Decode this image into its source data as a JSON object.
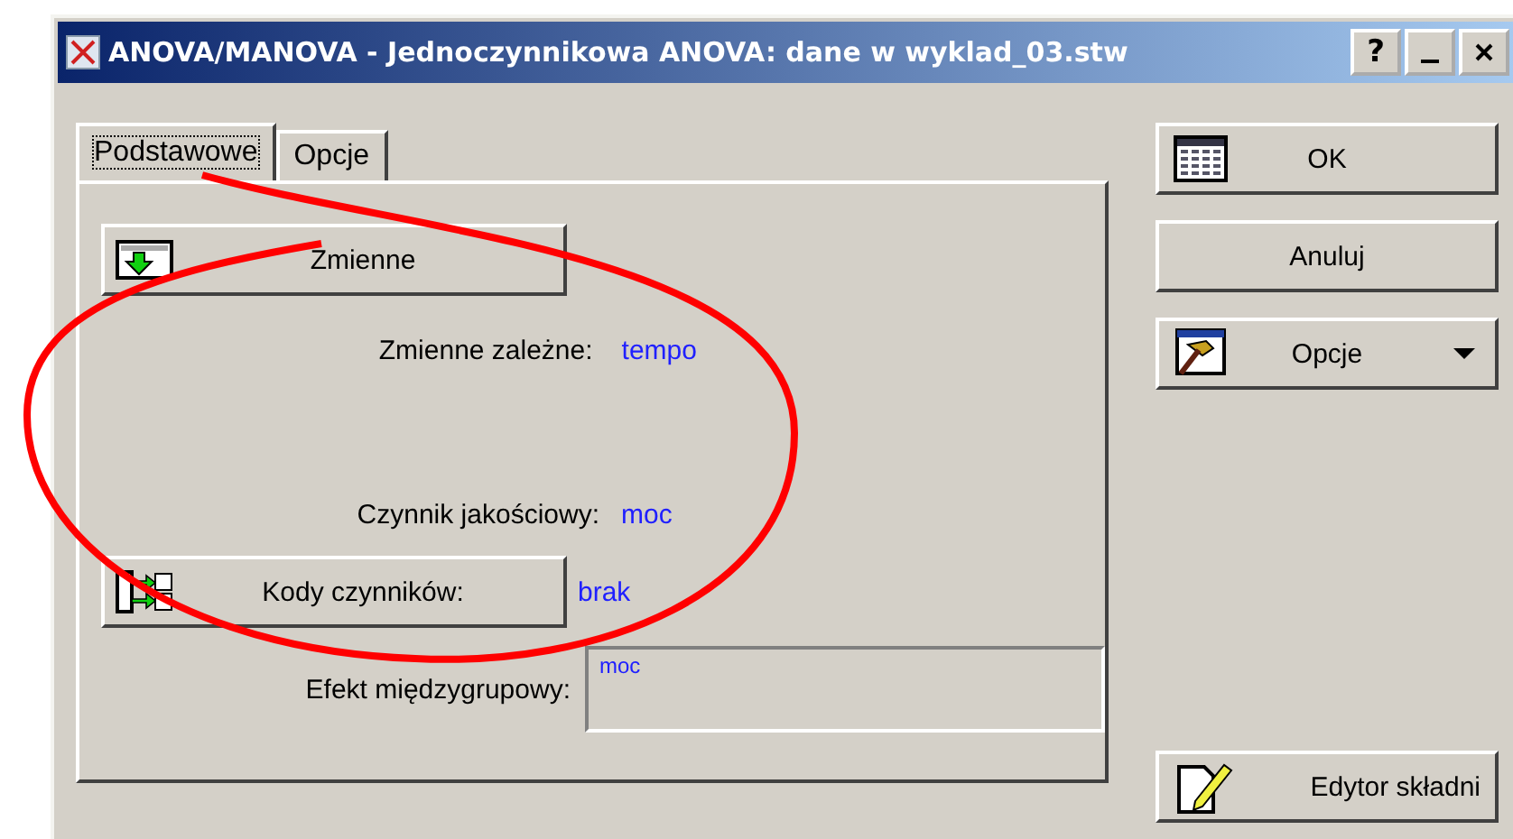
{
  "window": {
    "title": "ANOVA/MANOVA - Jednoczynnikowa ANOVA: dane w wyklad_03.stw",
    "help_button": "?"
  },
  "tabs": [
    {
      "label": "Podstawowe",
      "selected": true
    },
    {
      "label": "Opcje",
      "selected": false
    }
  ],
  "variables_button": "Zmienne",
  "fields": [
    {
      "label": "Zmienne zależne:",
      "value": "tempo"
    },
    {
      "label": "Czynnik jakościowy:",
      "value": "moc"
    }
  ],
  "factor_codes": {
    "button": "Kody czynników:",
    "value": "brak"
  },
  "between_effect": {
    "label": "Efekt międzygrupowy:",
    "value": "moc"
  },
  "side_buttons": [
    {
      "label": "OK",
      "kind": "ok"
    },
    {
      "label": "Anuluj",
      "kind": "plain"
    },
    {
      "label": "Opcje",
      "kind": "menu"
    }
  ],
  "syntax_button": "Edytor składni"
}
